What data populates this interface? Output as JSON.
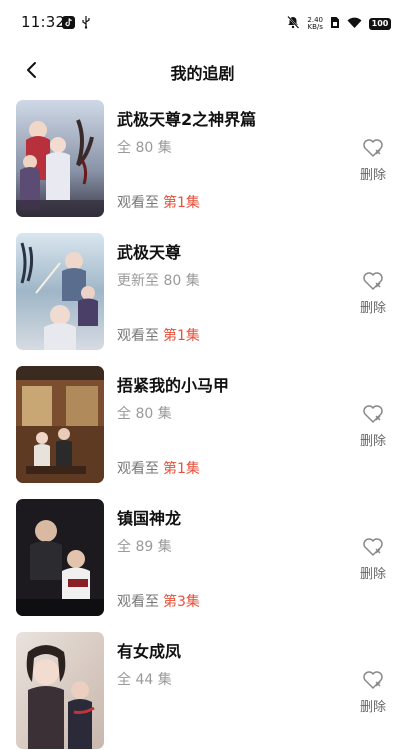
{
  "status": {
    "time": "11:32",
    "net_speed_value": "2.40",
    "net_speed_unit": "KB/s",
    "battery": "100"
  },
  "header": {
    "title": "我的追剧"
  },
  "items": [
    {
      "title": "武极天尊2之神界篇",
      "episodes": "全 80 集",
      "progress_prefix": "观看至",
      "progress_ep": "第1集",
      "delete": "删除",
      "poster_icon": "poster-fantasy-warriors"
    },
    {
      "title": "武极天尊",
      "episodes": "更新至 80 集",
      "progress_prefix": "观看至",
      "progress_ep": "第1集",
      "delete": "删除",
      "poster_icon": "poster-fantasy-hero"
    },
    {
      "title": "捂紧我的小马甲",
      "episodes": "全 80 集",
      "progress_prefix": "观看至",
      "progress_ep": "第1集",
      "delete": "删除",
      "poster_icon": "poster-drama-room"
    },
    {
      "title": "镇国神龙",
      "episodes": "全 89 集",
      "progress_prefix": "观看至",
      "progress_ep": "第3集",
      "delete": "删除",
      "poster_icon": "poster-dark-action"
    },
    {
      "title": "有女成凤",
      "episodes": "全 44 集",
      "progress_prefix": "",
      "progress_ep": "",
      "delete": "删除",
      "poster_icon": "poster-woman-portrait"
    }
  ],
  "colors": {
    "accent": "#e8503a",
    "muted": "#9a9a9a"
  }
}
